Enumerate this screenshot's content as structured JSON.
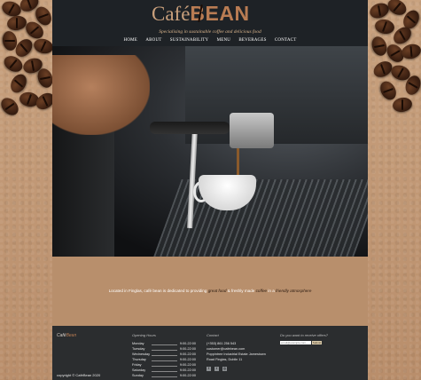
{
  "brand": {
    "logo_cafe": "Café",
    "logo_bean": "BEAN",
    "tagline": "Specialising in sustainable coffee and delicious food"
  },
  "nav": {
    "items": [
      "HOME",
      "ABOUT",
      "SUSTAINABILITY",
      "MENU",
      "BEVERAGES",
      "CONTACT"
    ]
  },
  "hero": {
    "image_icon": "espresso-machine-photo"
  },
  "intro": {
    "part1": "Located in Finglas, café bean is dedicated to providing ",
    "hl1": "great food",
    "part2": " & freshly made ",
    "hl2": "coffee",
    "part3": " in a ",
    "hl3": "friendly atmosphere"
  },
  "footer": {
    "logo_a": "Café",
    "logo_b": "Bean",
    "copyright": "copyright © CaféBean 2020",
    "hours_heading": "Opening Hours",
    "hours": [
      {
        "day": "Monday",
        "time": "9:00-22:00"
      },
      {
        "day": "Tuesday",
        "time": "9:00-22:00"
      },
      {
        "day": "Wednesday",
        "time": "9:00-22:00"
      },
      {
        "day": "Thursday",
        "time": "9:00-22:00"
      },
      {
        "day": "Friday",
        "time": "9:00-22:00"
      },
      {
        "day": "Saturday",
        "time": "9:00-22:00"
      },
      {
        "day": "Sunday",
        "time": "9:00-22:00"
      }
    ],
    "contact_heading": "Contact",
    "contact": {
      "phone": "(+353) 861 256 543",
      "email": "customer@cafebean.com",
      "address1": "Poppintree Industrial Estate Jamestown",
      "address2": "Road Finglas, Dublin 11"
    },
    "social_icons": [
      "facebook-icon",
      "twitter-icon",
      "instagram-icon"
    ],
    "newsletter_heading": "Do you want to receive offers?",
    "newsletter_placeholder": "email@example.com",
    "newsletter_button": "Submit"
  },
  "colors": {
    "header_bg": "#1e2226",
    "page_bg": "#b88f6c",
    "footer_bg": "#2b2d2f",
    "accent": "#b97c53"
  }
}
